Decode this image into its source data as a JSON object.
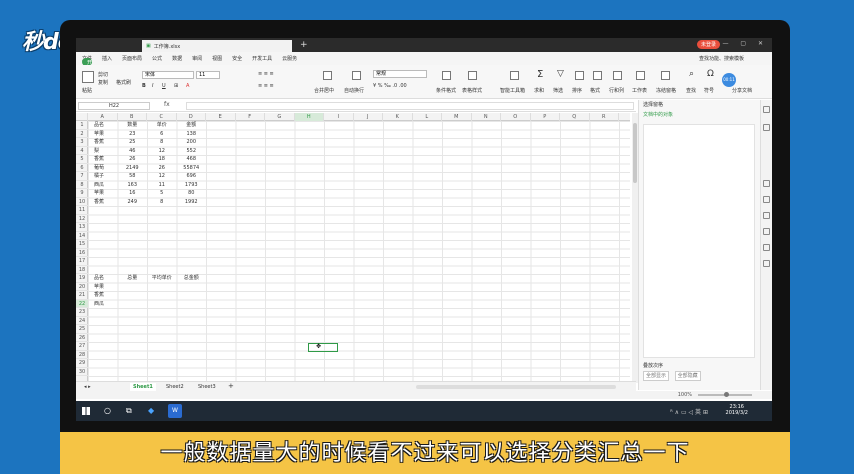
{
  "watermark": {
    "logo_text": "秒dong视频"
  },
  "titlebar": {
    "doc_name": "工作簿.xlsx",
    "login_label": "未登录"
  },
  "menu": {
    "file": "文件",
    "items": [
      "开始",
      "插入",
      "页面布局",
      "公式",
      "数据",
      "审阅",
      "视图",
      "安全",
      "开发工具",
      "云服务"
    ],
    "search": "查找功能、搜索模板"
  },
  "ribbon": {
    "cut": "剪切",
    "paste": "粘贴",
    "copy": "复制",
    "format_painter": "格式刷",
    "font_name": "宋体",
    "font_size": "11",
    "merge_center": "合并居中",
    "wrap": "自动换行",
    "number_format": "常规",
    "conditional": "条件格式",
    "table_style": "表格样式",
    "smart_toolbox": "智能工具箱",
    "sum": "求和",
    "filter": "筛选",
    "sort": "排序",
    "format": "格式",
    "rows_cols": "行和列",
    "worksheet": "工作表",
    "freeze": "冻结窗格",
    "find": "查找",
    "symbol": "符号",
    "share": "分享文档",
    "circle_label": "00:11"
  },
  "formula": {
    "namebox": "H22",
    "fx": "fx"
  },
  "columns": [
    "A",
    "B",
    "C",
    "D",
    "E",
    "F",
    "G",
    "H",
    "I",
    "J",
    "K",
    "L",
    "M",
    "N",
    "O",
    "P",
    "Q",
    "R"
  ],
  "rows": [
    "1",
    "2",
    "3",
    "4",
    "5",
    "6",
    "7",
    "8",
    "9",
    "10",
    "11",
    "12",
    "13",
    "14",
    "15",
    "16",
    "17",
    "18",
    "19",
    "20",
    "21",
    "22",
    "23",
    "24",
    "25",
    "26",
    "27",
    "28",
    "29",
    "30"
  ],
  "table1": {
    "headers": [
      "品名",
      "数量",
      "单价",
      "金额"
    ],
    "rows": [
      [
        "苹果",
        "23",
        "6",
        "138"
      ],
      [
        "香蕉",
        "25",
        "8",
        "200"
      ],
      [
        "梨",
        "46",
        "12",
        "552"
      ],
      [
        "香蕉",
        "26",
        "18",
        "468"
      ],
      [
        "葡萄",
        "2149",
        "26",
        "55874"
      ],
      [
        "橘子",
        "58",
        "12",
        "696"
      ],
      [
        "西瓜",
        "163",
        "11",
        "1793"
      ],
      [
        "苹果",
        "16",
        "5",
        "80"
      ],
      [
        "香蕉",
        "249",
        "8",
        "1992"
      ]
    ]
  },
  "table2": {
    "headers": [
      "品名",
      "总量",
      "平均单价",
      "总金额"
    ],
    "rows": [
      [
        "苹果"
      ],
      [
        "香蕉"
      ],
      [
        "西瓜"
      ]
    ]
  },
  "sheets": [
    "Sheet1",
    "Sheet2",
    "Sheet3"
  ],
  "panel": {
    "title": "选择窗格",
    "subtitle": "文档中的对象",
    "order_label": "叠放次序",
    "show_all": "全部显示",
    "hide_all": "全部隐藏"
  },
  "status": {
    "zoom": "100%"
  },
  "taskbar": {
    "time": "23:16",
    "date": "2019/3/2"
  },
  "caption": "一般数据量大的时候看不过来可以选择分类汇总一下"
}
